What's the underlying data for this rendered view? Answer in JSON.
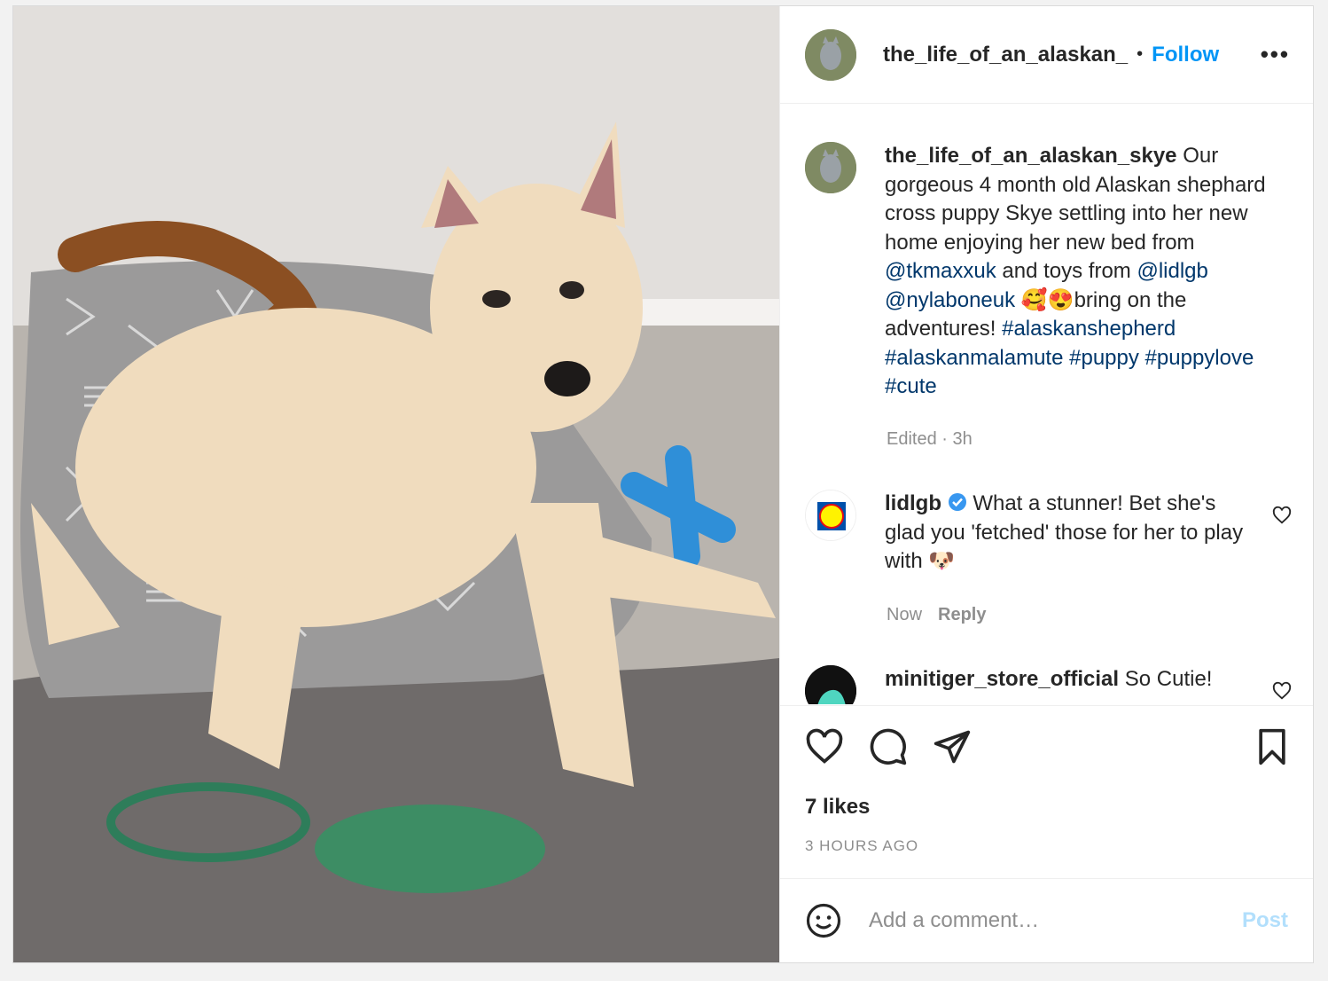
{
  "post": {
    "username": "the_life_of_an_alaskan_",
    "follow_label": "Follow",
    "more_label": "•••"
  },
  "caption": {
    "username": "the_life_of_an_alaskan_skye",
    "text_1": "Our gorgeous 4 month old Alaskan shephard cross puppy Skye settling into her new home enjoying her new bed from ",
    "mention_1": "@tkmaxxuk",
    "text_2": " and toys from ",
    "mention_2": "@lidlgb",
    "mention_3": "@nylaboneuk",
    "emoji": "🥰😍",
    "text_3": "bring on the adventures! ",
    "tags": [
      "#alaskanshepherd",
      "#alaskanmalamute",
      "#puppy",
      "#puppylove",
      "#cute"
    ],
    "meta": "Edited · 3h"
  },
  "comments": [
    {
      "username": "lidlgb",
      "text": "What a stunner! Bet she's glad you 'fetched' those for her to play with ",
      "emoji": "🐶",
      "time": "Now",
      "reply": "Reply"
    },
    {
      "username": "minitiger_store_official",
      "text": "So Cutie!"
    }
  ],
  "likes": "7 likes",
  "ago": "3 HOURS AGO",
  "add_comment_placeholder": "Add a comment…",
  "post_label": "Post",
  "colors": {
    "accent": "#0095f6",
    "link": "#00376b",
    "post_disabled": "#b2dffc"
  }
}
